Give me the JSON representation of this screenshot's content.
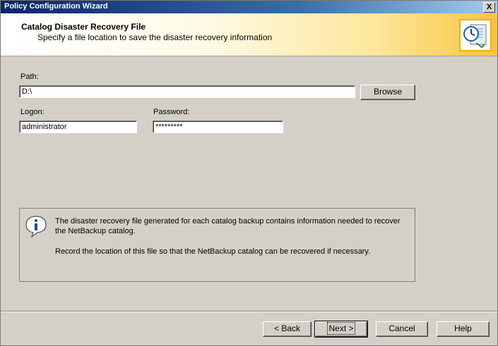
{
  "window": {
    "title": "Policy Configuration Wizard",
    "close_label": "X"
  },
  "header": {
    "title": "Catalog Disaster Recovery File",
    "subtitle": "Specify a file location to save the disaster recovery information"
  },
  "form": {
    "path_label": "Path:",
    "path_value": "D:\\",
    "browse_label": "Browse",
    "logon_label": "Logon:",
    "logon_value": "administrator",
    "password_label": "Password:",
    "password_value": "*********"
  },
  "info": {
    "text1": "The disaster recovery file generated for each catalog backup contains information needed to recover the NetBackup catalog.",
    "text2": "Record the location of this file so that the NetBackup catalog can be recovered if necessary."
  },
  "buttons": {
    "back": "< Back",
    "next": "Next >",
    "cancel": "Cancel",
    "help": "Help"
  },
  "icons": {
    "header": "wizard-clock-icon",
    "info": "info-balloon-icon"
  }
}
